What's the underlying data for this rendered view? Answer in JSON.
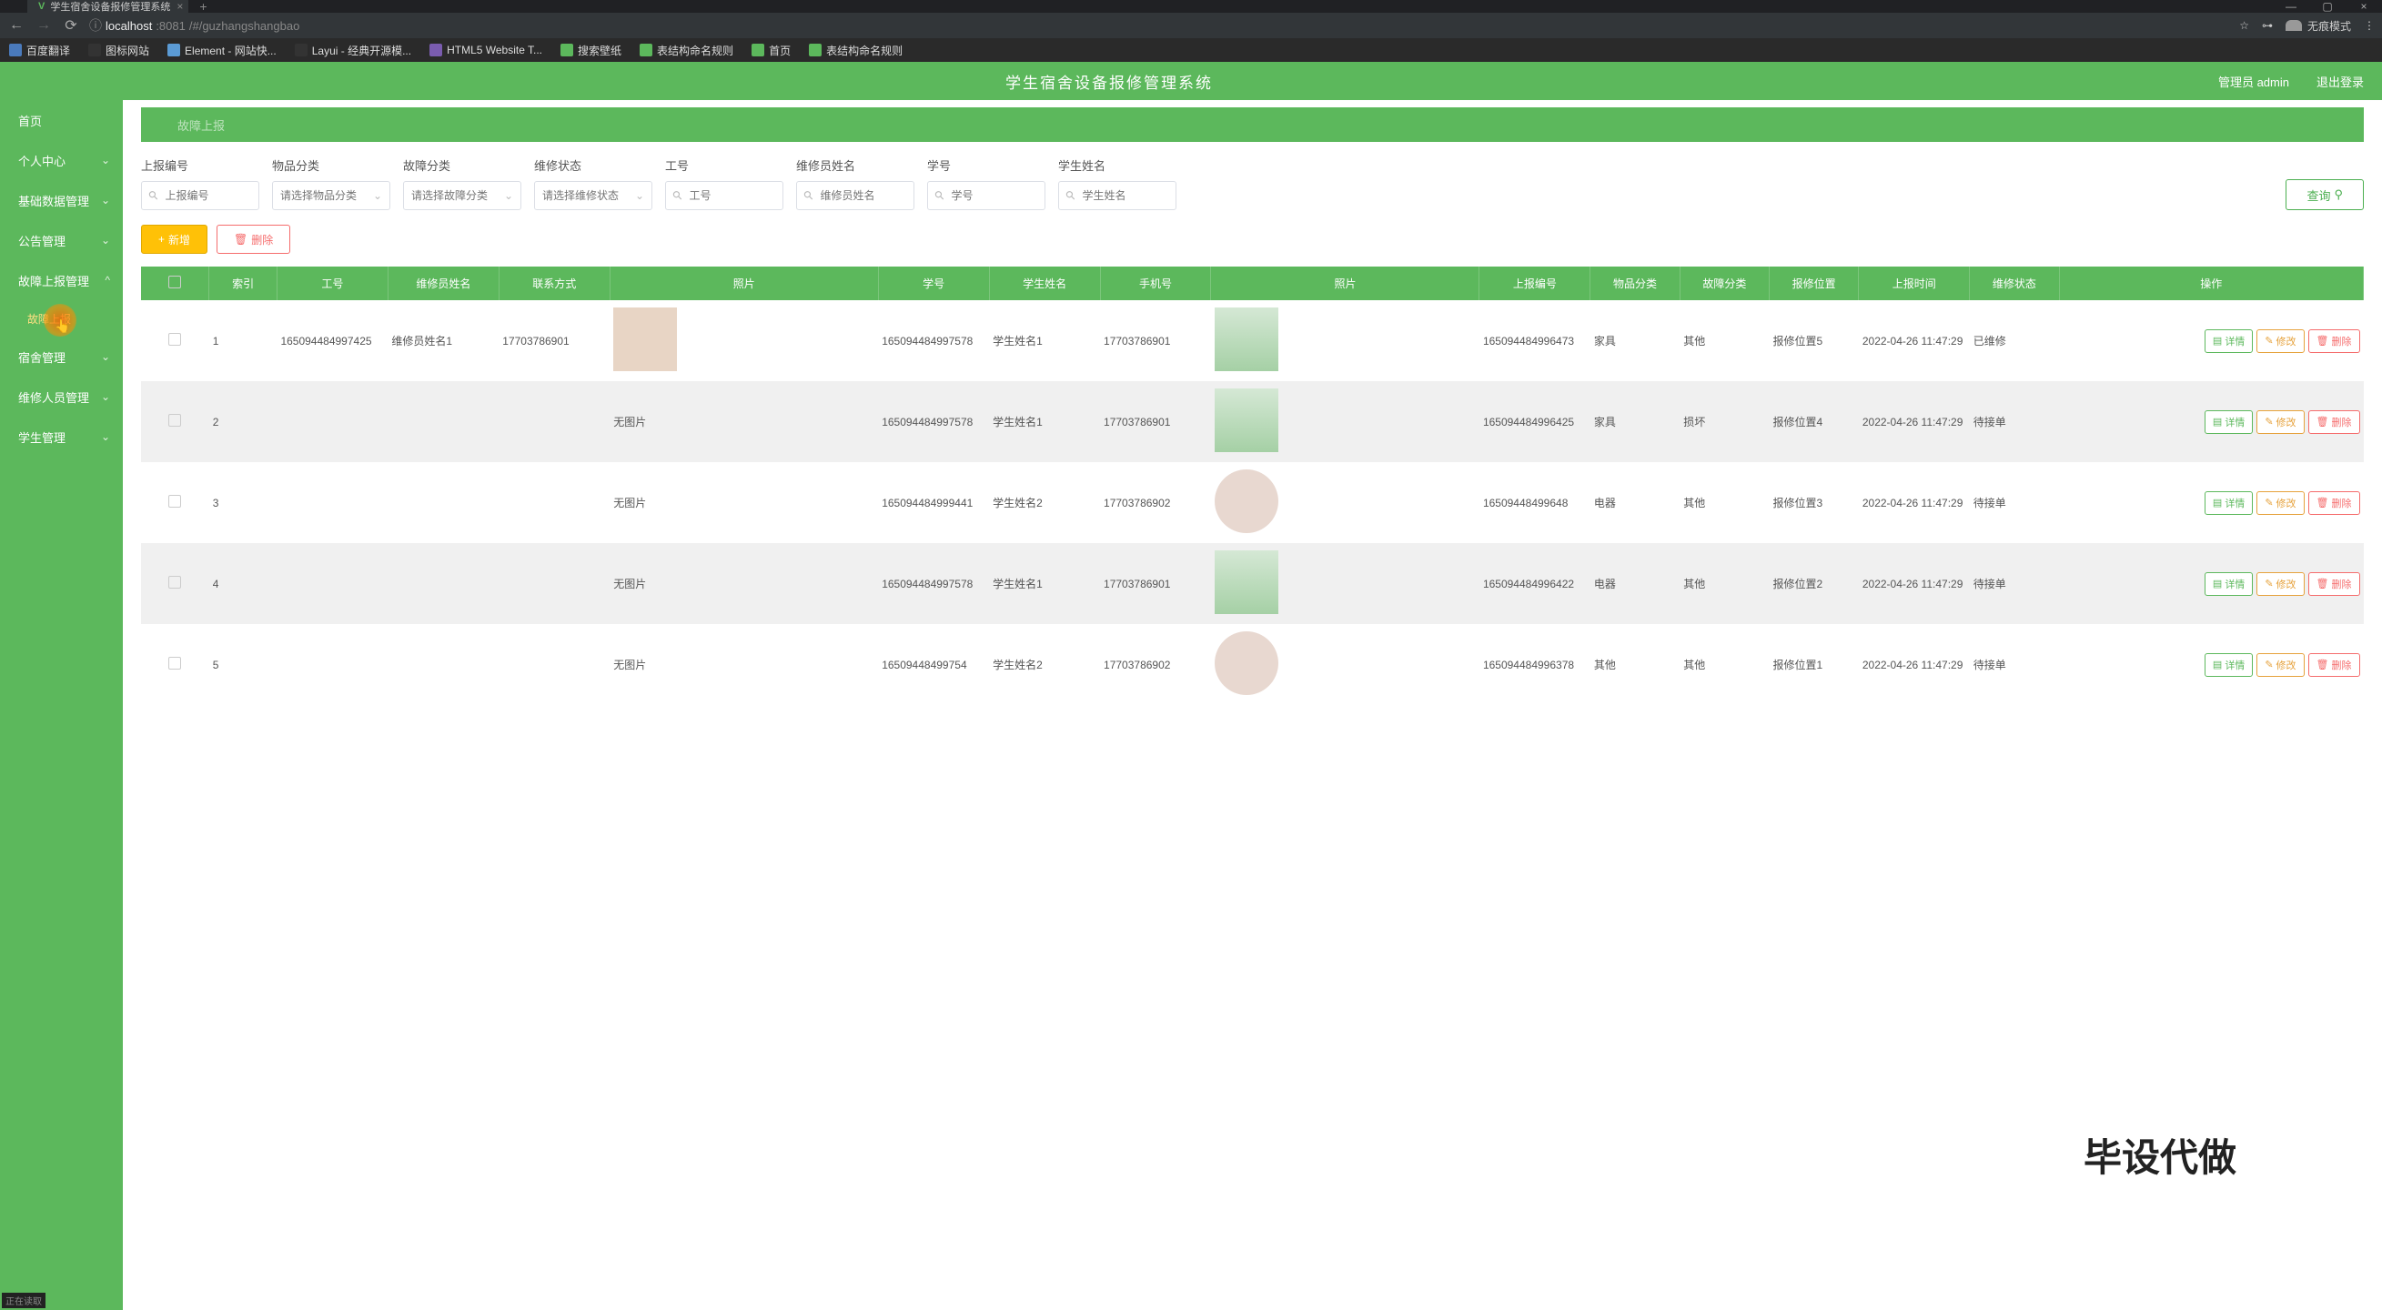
{
  "browser": {
    "tab_title": "学生宿舍设备报修管理系统",
    "url_host": "localhost",
    "url_port": ":8081",
    "url_path": "/#/guzhangshangbao",
    "incognito": "无痕模式",
    "bookmarks": [
      {
        "label": "百度翻译"
      },
      {
        "label": "图标网站"
      },
      {
        "label": "Element - 网站快..."
      },
      {
        "label": "Layui - 经典开源模..."
      },
      {
        "label": "HTML5 Website T..."
      },
      {
        "label": "搜索壁纸"
      },
      {
        "label": "表结构命名规则"
      },
      {
        "label": "首页"
      },
      {
        "label": "表结构命名规则"
      }
    ]
  },
  "app": {
    "title": "学生宿舍设备报修管理系统",
    "user": "管理员 admin",
    "logout": "退出登录"
  },
  "sidebar": {
    "items": [
      {
        "label": "首页",
        "sub": false
      },
      {
        "label": "个人中心",
        "sub": true
      },
      {
        "label": "基础数据管理",
        "sub": true
      },
      {
        "label": "公告管理",
        "sub": true
      },
      {
        "label": "故障上报管理",
        "sub": true,
        "expanded": true
      },
      {
        "label": "宿舍管理",
        "sub": true
      },
      {
        "label": "维修人员管理",
        "sub": true
      },
      {
        "label": "学生管理",
        "sub": true
      }
    ],
    "sub_active": "故障上报"
  },
  "crumb": "故障上报",
  "filters": {
    "f1": {
      "label": "上报编号",
      "placeholder": "上报编号"
    },
    "f2": {
      "label": "物品分类",
      "placeholder": "请选择物品分类"
    },
    "f3": {
      "label": "故障分类",
      "placeholder": "请选择故障分类"
    },
    "f4": {
      "label": "维修状态",
      "placeholder": "请选择维修状态"
    },
    "f5": {
      "label": "工号",
      "placeholder": "工号"
    },
    "f6": {
      "label": "维修员姓名",
      "placeholder": "维修员姓名"
    },
    "f7": {
      "label": "学号",
      "placeholder": "学号"
    },
    "f8": {
      "label": "学生姓名",
      "placeholder": "学生姓名"
    },
    "query": "查询"
  },
  "buttons": {
    "add": "新增",
    "del": "删除"
  },
  "table": {
    "headers": [
      "",
      "索引",
      "工号",
      "维修员姓名",
      "联系方式",
      "照片",
      "学号",
      "学生姓名",
      "手机号",
      "照片",
      "上报编号",
      "物品分类",
      "故障分类",
      "报修位置",
      "上报时间",
      "维修状态",
      "操作"
    ],
    "ops": {
      "detail": "详情",
      "edit": "修改",
      "delete": "删除"
    },
    "rows": [
      {
        "idx": "1",
        "gong": "165094484997425",
        "wname": "维修员姓名1",
        "phone": "17703786901",
        "pic1": true,
        "xue": "165094484997578",
        "sname": "学生姓名1",
        "sphone": "17703786901",
        "pic2": true,
        "code": "165094484996473",
        "cat": "家具",
        "fcat": "其他",
        "loc": "报修位置5",
        "time": "2022-04-26 11:47:29",
        "status": "已维修"
      },
      {
        "idx": "2",
        "gong": "",
        "wname": "",
        "phone": "",
        "pic1": false,
        "pic1txt": "无图片",
        "xue": "165094484997578",
        "sname": "学生姓名1",
        "sphone": "17703786901",
        "pic2": true,
        "code": "165094484996425",
        "cat": "家具",
        "fcat": "损坏",
        "loc": "报修位置4",
        "time": "2022-04-26 11:47:29",
        "status": "待接单"
      },
      {
        "idx": "3",
        "gong": "",
        "wname": "",
        "phone": "",
        "pic1": false,
        "pic1txt": "无图片",
        "xue": "165094484999441",
        "sname": "学生姓名2",
        "sphone": "17703786902",
        "pic2": true,
        "round": true,
        "code": "16509448499648",
        "cat": "电器",
        "fcat": "其他",
        "loc": "报修位置3",
        "time": "2022-04-26 11:47:29",
        "status": "待接单"
      },
      {
        "idx": "4",
        "gong": "",
        "wname": "",
        "phone": "",
        "pic1": false,
        "pic1txt": "无图片",
        "xue": "165094484997578",
        "sname": "学生姓名1",
        "sphone": "17703786901",
        "pic2": true,
        "code": "165094484996422",
        "cat": "电器",
        "fcat": "其他",
        "loc": "报修位置2",
        "time": "2022-04-26 11:47:29",
        "status": "待接单"
      },
      {
        "idx": "5",
        "gong": "",
        "wname": "",
        "phone": "",
        "pic1": false,
        "pic1txt": "无图片",
        "xue": "16509448499754",
        "sname": "学生姓名2",
        "sphone": "17703786902",
        "pic2": true,
        "round": true,
        "code": "165094484996378",
        "cat": "其他",
        "fcat": "其他",
        "loc": "报修位置1",
        "time": "2022-04-26 11:47:29",
        "status": "待接单"
      }
    ]
  },
  "watermark": "毕设代做",
  "hash": "正在读取"
}
